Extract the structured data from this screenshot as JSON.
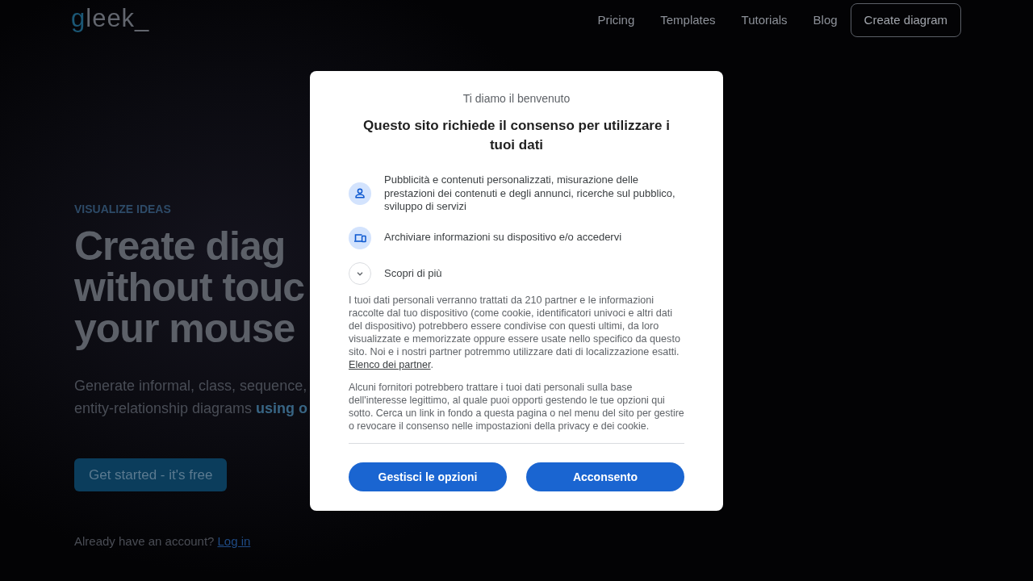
{
  "header": {
    "logo": "gleek_",
    "nav": [
      "Pricing",
      "Templates",
      "Tutorials",
      "Blog"
    ],
    "cta": "Create diagram"
  },
  "hero": {
    "eyebrow": "VISUALIZE IDEAS",
    "headline_lines": [
      "Create diag",
      "without touc",
      "your mouse"
    ],
    "subtitle_lines": [
      "Generate informal, class, sequence,",
      "entity-relationship diagrams **using o**"
    ],
    "cta": "Get started - it's free",
    "login_prompt": "Already have an account?",
    "login_link": "Log in"
  },
  "consent_dialog": {
    "greeting": "Ti diamo il benvenuto",
    "title": "Questo sito richiede il consenso per utilizzare i tuoi dati",
    "purposes": [
      {
        "kind": "ads",
        "text": "Pubblicità e contenuti personalizzati, misurazione delle prestazioni dei contenuti e degli annunci, ricerche sul pubblico, sviluppo di servizi"
      },
      {
        "kind": "storage",
        "text": "Archiviare informazioni su dispositivo e/o accedervi"
      }
    ],
    "more": {
      "label": "Scopri di più",
      "expanded": false
    },
    "notice": {
      "text": "I tuoi dati personali verranno trattati da 210 partner e le informazioni raccolte dal tuo dispositivo (come cookie, identificatori univoci e altri dati del dispositivo) potrebbero essere condivise con questi ultimi, da loro visualizzate e memorizzate oppure essere usate nello specifico da questo sito. Noi e i nostri partner potremmo utilizzare dati di localizzazione esatti.",
      "link": "Elenco dei partner",
      "after_link": "."
    },
    "legitimate_interest": "Alcuni fornitori potrebbero trattare i tuoi dati personali sulla base dell'interesse legittimo, al quale puoi opporti gestendo le tue opzioni qui sotto. Cerca un link in fondo a questa pagina o nel menu del sito per gestire o revocare il consenso nelle impostazioni della privacy e dei cookie.",
    "buttons": [
      "Gestisci le opzioni",
      "Acconsento"
    ]
  }
}
